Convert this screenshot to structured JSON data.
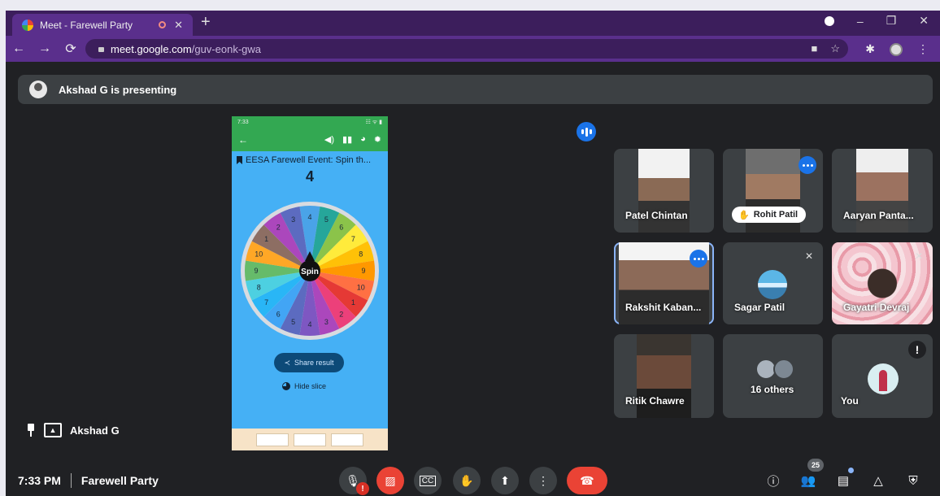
{
  "browser": {
    "tab_title": "Meet - Farewell Party",
    "tab_close": "✕",
    "new_tab": "+",
    "url_host": "meet.google.com",
    "url_path": "/guv-eonk-gwa",
    "window_minimize": "–",
    "window_restore": "❐",
    "window_close": "✕"
  },
  "presenting_banner": "Akshad G is presenting",
  "phone": {
    "status_time": "7:33",
    "status_icons": "☷ ᯤ ▮",
    "event_title": "EESA Farewell Event: Spin th...",
    "result_number": "4",
    "spin_label": "Spin",
    "share_result": "Share result",
    "hide_slice": "Hide slice",
    "wheel_numbers": [
      "4",
      "5",
      "6",
      "7",
      "8",
      "9",
      "10",
      "1",
      "2",
      "3",
      "4",
      "5",
      "6",
      "7",
      "8",
      "9",
      "10",
      "1",
      "2",
      "3"
    ],
    "wheel_colors": [
      "#4aa3e8",
      "#26a69a",
      "#8bc34a",
      "#ffeb3b",
      "#ffc107",
      "#ff9800",
      "#ff7043",
      "#e53935",
      "#ec407a",
      "#ab47bc",
      "#7e57c2",
      "#5c6bc0",
      "#42a5f5",
      "#29b6f6",
      "#4dd0e1",
      "#66bb6a",
      "#ffa726",
      "#8d6e63",
      "#ab47bc",
      "#5c6bc0"
    ]
  },
  "participants": [
    {
      "name": "Patel Chintan"
    },
    {
      "name": "Rohit Patil"
    },
    {
      "name": "Aaryan Panta..."
    },
    {
      "name": "Rakshit Kaban..."
    },
    {
      "name": "Sagar Patil"
    },
    {
      "name": "Gayatri Devraj"
    },
    {
      "name": "Ritik Chawre"
    },
    {
      "name": "16 others"
    },
    {
      "name": "You"
    }
  ],
  "presenter_label": "Akshad G",
  "footer": {
    "time": "7:33 PM",
    "meeting_name": "Farewell Party",
    "warn_badge": "!",
    "people_count": "25",
    "you_alert": "!"
  },
  "colors": {
    "meet_blue": "#1a73e8",
    "end_call_red": "#ea4335",
    "panel_gray": "#3c4043",
    "background": "#202124"
  }
}
